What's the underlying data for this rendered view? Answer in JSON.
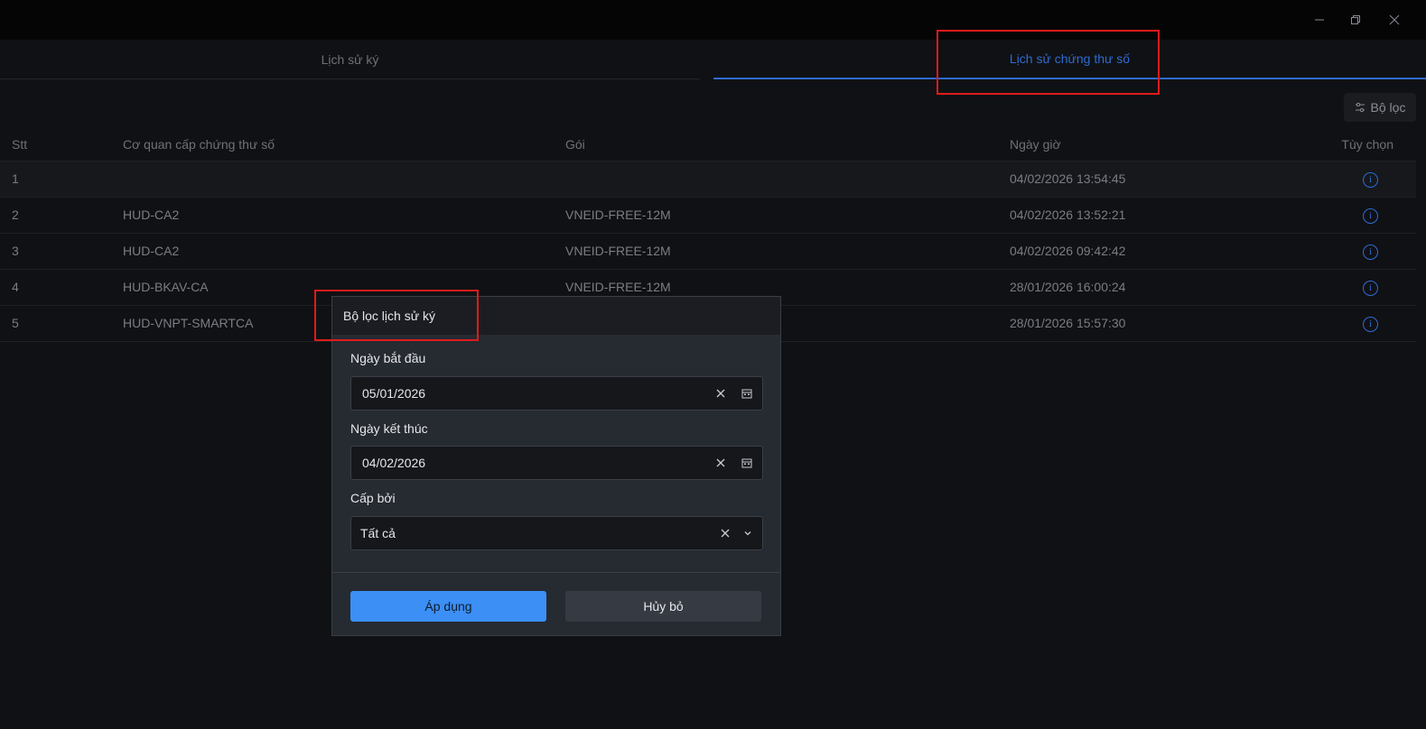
{
  "window": {
    "minimize_label": "minimize",
    "restore_label": "restore",
    "close_label": "close"
  },
  "tabs": [
    {
      "label": "Lịch sử ký",
      "active": false
    },
    {
      "label": "Lịch sử chứng thư số",
      "active": true
    }
  ],
  "toolbar": {
    "filter_label": "Bộ lọc"
  },
  "table": {
    "columns": [
      "Stt",
      "Cơ quan cấp chứng thư số",
      "Gói",
      "Ngày giờ",
      "Tùy chọn"
    ],
    "rows": [
      {
        "stt": "1",
        "issuer": "",
        "package": "",
        "datetime": "04/02/2026 13:54:45"
      },
      {
        "stt": "2",
        "issuer": "HUD-CA2",
        "package": "VNEID-FREE-12M",
        "datetime": "04/02/2026 13:52:21"
      },
      {
        "stt": "3",
        "issuer": "HUD-CA2",
        "package": "VNEID-FREE-12M",
        "datetime": "04/02/2026 09:42:42"
      },
      {
        "stt": "4",
        "issuer": "HUD-BKAV-CA",
        "package": "VNEID-FREE-12M",
        "datetime": "28/01/2026 16:00:24"
      },
      {
        "stt": "5",
        "issuer": "HUD-VNPT-SMARTCA",
        "package": "",
        "datetime": "28/01/2026 15:57:30"
      }
    ]
  },
  "filter_dialog": {
    "title": "Bộ lọc lịch sử ký",
    "start_label": "Ngày bắt đầu",
    "start_value": "05/01/2026",
    "end_label": "Ngày kết thúc",
    "end_value": "04/02/2026",
    "issuer_label": "Cấp bởi",
    "issuer_value": "Tất cả",
    "apply_label": "Áp dụng",
    "cancel_label": "Hủy bỏ"
  },
  "colors": {
    "accent": "#2f6bd0",
    "primary_button": "#3b8ff5",
    "highlight": "#e01b1b",
    "background": "#101114"
  }
}
